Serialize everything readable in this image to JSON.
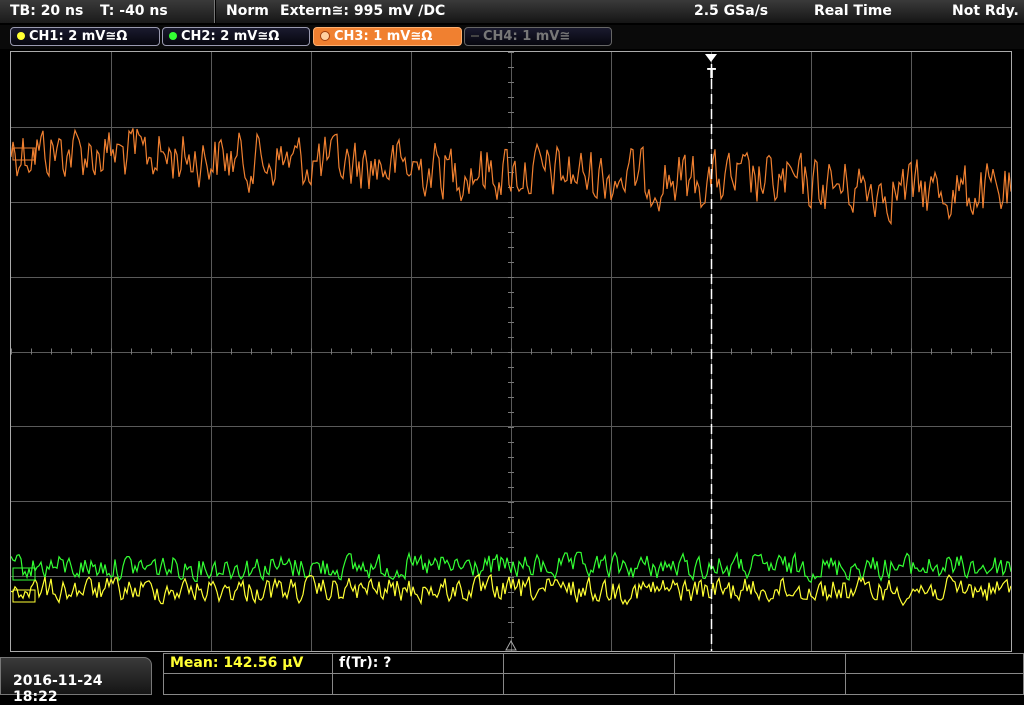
{
  "timebase": {
    "tb": "TB: 20 ns",
    "trigger_pos": "T: -40 ns"
  },
  "status": {
    "mode": "Norm",
    "trigger": "Extern≅: 995 mV ∕DC",
    "sample_rate": "2.5 GSa/s",
    "acq": "Real Time",
    "state": "Not Rdy."
  },
  "channels": [
    {
      "label": "CH1: 2 mV≅Ω",
      "color": "#ffff33",
      "state": "on"
    },
    {
      "label": "CH2: 2 mV≅Ω",
      "color": "#33ff33",
      "state": "on"
    },
    {
      "label": "CH3: 1 mV≅Ω",
      "color": "#f08030",
      "state": "active"
    },
    {
      "label": "CH4: 1 mV≅",
      "color": "#555555",
      "state": "off"
    }
  ],
  "screen": {
    "trigger_marker": "T"
  },
  "measurement": {
    "mean": "Mean: 142.56 µV",
    "freq": "f(Tr): ?"
  },
  "datetime": "2016-11-24 18:22",
  "colors": {
    "ch1": "#ffff33",
    "ch2": "#33ff33",
    "ch3": "#f08030",
    "grid": "#5a5a5a"
  }
}
